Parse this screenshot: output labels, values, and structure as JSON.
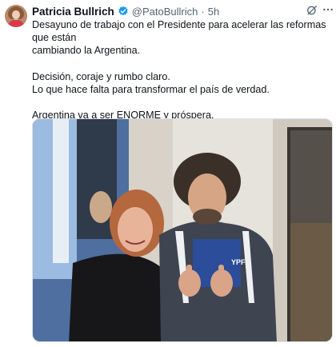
{
  "tweet": {
    "author_name": "Patricia Bullrich",
    "handle": "@PatoBullrich",
    "separator": "·",
    "time": "5h",
    "paragraphs": [
      "Desayuno de trabajo con el Presidente para acelerar las reformas que están\ncambiando la Argentina.",
      "Decisión, coraje y rumbo claro.\nLo que hace falta para transformar el país de verdad.",
      "Argentina va a ser ENORME y próspera.\nY no hay vuelta atrás."
    ],
    "photo_logo_text": "YPF"
  },
  "icons": {
    "verified": "verified-badge-icon",
    "grok": "grok-icon",
    "more": "more-options-icon"
  },
  "colors": {
    "verified_blue": "#1d9bf0",
    "text_primary": "#0f1419",
    "text_secondary": "#536471"
  }
}
